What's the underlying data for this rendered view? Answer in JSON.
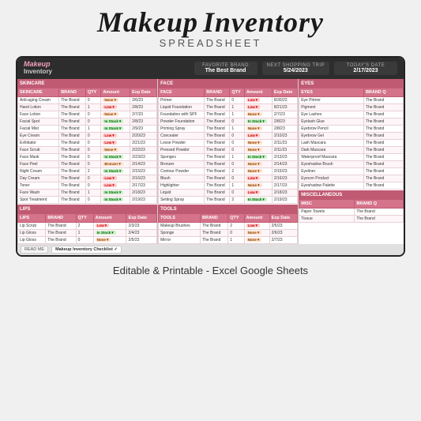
{
  "title": {
    "line1_part1": "Makeup",
    "line1_part2": "Inventory",
    "line2": "Spreadsheet"
  },
  "spreadsheet": {
    "logo_line1": "Makeup",
    "logo_line2": "Inventory",
    "fields": [
      {
        "label": "Favorite Brand",
        "value": "The Best Brand"
      },
      {
        "label": "Next Shopping Trip",
        "value": "5/24/2023"
      },
      {
        "label": "Today's Date",
        "value": "2/17/2023"
      }
    ],
    "sections": {
      "skincare": {
        "header": "SKINCARE",
        "columns": [
          "BRAND",
          "QTY",
          "Amount",
          "Exp Date"
        ],
        "rows": [
          [
            "Anti-aging Cream",
            "The Brand",
            "0",
            "None▼",
            "2/6/23"
          ],
          [
            "Hand Lotion",
            "The Brand",
            "1",
            "Low▼",
            "2/8/23"
          ],
          [
            "Face Lotion",
            "The Brand",
            "0",
            "None▼",
            "2/7/23"
          ],
          [
            "Facial Spot",
            "The Brand",
            "0",
            "In Stock▼",
            "2/8/23"
          ],
          [
            "Facial Mist",
            "The Brand",
            "1",
            "In Stock▼",
            "2/9/23"
          ],
          [
            "Eye Cream",
            "The Brand",
            "0",
            "Low▼",
            "2/20/23"
          ],
          [
            "Exfoliator",
            "The Brand",
            "0",
            "Low▼",
            "2/21/23"
          ],
          [
            "Face Scrub",
            "The Brand",
            "0",
            "None▼",
            "2/22/23"
          ],
          [
            "Face Mask",
            "The Brand",
            "0",
            "In Stock▼",
            "2/23/23"
          ],
          [
            "Face Peel",
            "The Brand",
            "0",
            "Bronzer▼",
            "2/14/23"
          ],
          [
            "Night Cream",
            "The Brand",
            "2",
            "In Stock▼",
            "2/15/23"
          ],
          [
            "Day Cream",
            "The Brand",
            "0",
            "Low▼",
            "2/16/23"
          ],
          [
            "Toner",
            "The Brand",
            "0",
            "Low▼",
            "2/17/23"
          ],
          [
            "Face Wash",
            "The Brand",
            "1",
            "In Stock▼",
            "2/18/23"
          ],
          [
            "Spot Treatment",
            "The Brand",
            "0",
            "In Stock▼",
            "2/19/23"
          ]
        ]
      },
      "face": {
        "header": "FACE",
        "columns": [
          "BRAND",
          "QTY",
          "Amount",
          "Exp Date"
        ],
        "rows": [
          [
            "Primer",
            "The Brand",
            "0",
            "Low▼",
            "8/30/23"
          ],
          [
            "Liquid Foundation",
            "The Brand",
            "1",
            "Low▼",
            "8/21/23"
          ],
          [
            "Foundation with SPF",
            "The Brand",
            "1",
            "None▼",
            "2/7/23"
          ],
          [
            "Powder Foundation",
            "The Brand",
            "0",
            "In Stock▼",
            "2/8/23"
          ],
          [
            "Priming Spray",
            "The Brand",
            "1",
            "None▼",
            "2/8/23"
          ],
          [
            "Concealer",
            "The Brand",
            "0",
            "Low▼",
            "2/10/23"
          ],
          [
            "Loose Powder",
            "The Brand",
            "0",
            "None▼",
            "2/11/23"
          ],
          [
            "Pressed Powder",
            "The Brand",
            "0",
            "None▼",
            "2/11/23"
          ],
          [
            "Sponges",
            "The Brand",
            "1",
            "In Stock▼",
            "2/13/23"
          ],
          [
            "Bronzer",
            "The Brand",
            "0",
            "None▼",
            "2/14/23"
          ],
          [
            "Contour Powder",
            "The Brand",
            "2",
            "None▼",
            "2/15/23"
          ],
          [
            "Blush",
            "The Brand",
            "0",
            "Low▼",
            "2/16/23"
          ],
          [
            "Highlighter",
            "The Brand",
            "1",
            "None▼",
            "2/17/23"
          ],
          [
            "Liquid",
            "The Brand",
            "0",
            "Low▼",
            "2/18/23"
          ],
          [
            "Setting Spray",
            "The Brand",
            "2",
            "In Stock▼",
            "2/19/23"
          ]
        ]
      },
      "eyes": {
        "header": "EYES",
        "columns": [
          "BRAND Q"
        ],
        "rows": [
          [
            "Eye Primer",
            "The Brand"
          ],
          [
            "Pigment",
            "The Brand"
          ],
          [
            "Eye Lashes",
            "The Brand"
          ],
          [
            "Eyelash Glue",
            "The Brand"
          ],
          [
            "Eyebrow Pencil",
            "The Brand"
          ],
          [
            "Eyebrow Gel",
            "The Brand"
          ],
          [
            "Lash Mascara",
            "The Brand"
          ],
          [
            "Dark Mascara",
            "The Brand"
          ],
          [
            "Waterproof Mascara",
            "The Brand"
          ],
          [
            "Eyeshadow Brush",
            "The Brand"
          ],
          [
            "Eyeliner",
            "The Brand"
          ],
          [
            "Eyecon Product",
            "The Brand"
          ],
          [
            "Eyeshadow Palette",
            "The Brand"
          ]
        ]
      },
      "lips": {
        "header": "LIPS",
        "columns": [
          "BRAND",
          "QTY",
          "Amount",
          "Exp Date"
        ],
        "rows": [
          [
            "Lip Scrub",
            "The Brand",
            "2",
            "Low▼",
            "2/3/23"
          ],
          [
            "Lip Gloss",
            "The Brand",
            "1",
            "In Stock▼",
            "2/4/23"
          ],
          [
            "Lip Gloss",
            "The Brand",
            "0",
            "None▼",
            "2/5/23"
          ]
        ]
      },
      "tools": {
        "header": "TOOLS",
        "columns": [
          "BRAND",
          "QTY",
          "Amount",
          "Exp Date"
        ],
        "rows": [
          [
            "Makeup Brushes",
            "The Brand",
            "2",
            "Low▼",
            "2/5/23"
          ],
          [
            "Sponge",
            "The Brand",
            "0",
            "None▼",
            "2/6/23"
          ],
          [
            "Mirror",
            "The Brand",
            "1",
            "None▼",
            "2/7/23"
          ]
        ]
      },
      "miscellaneous": {
        "header": "MISCELLANEOUS",
        "columns": [
          "BRAND Q"
        ],
        "rows": [
          [
            "Paper Towels",
            "The Brand"
          ],
          [
            "Tissue",
            "The Brand"
          ]
        ]
      }
    }
  },
  "bottom": {
    "text": "Editable & Printable - Excel Google Sheets"
  },
  "tabs": [
    {
      "label": "READ ME",
      "active": false
    },
    {
      "label": "Makeup Inventory Checklist",
      "active": true
    }
  ]
}
